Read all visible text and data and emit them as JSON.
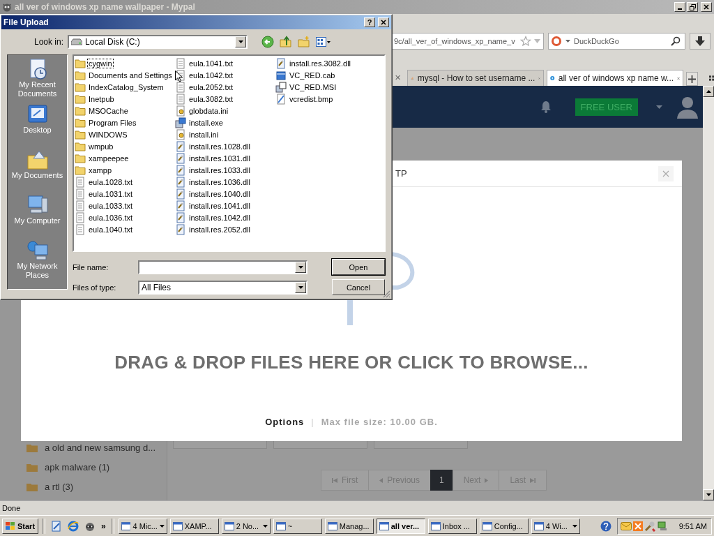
{
  "browser": {
    "title": "all ver of windows xp name wallpaper - Mypal",
    "address": {
      "value": "9c/all_ver_of_windows_xp_name_v"
    },
    "search": {
      "placeholder": "DuckDuckGo"
    },
    "tabs": [
      {
        "label": "mysql - How to set username ...",
        "selected": false
      },
      {
        "label": "all ver of windows xp name w...",
        "selected": true
      }
    ],
    "status": "Done"
  },
  "page": {
    "badge": "FREE USER",
    "folders": [
      "a old and new samsung d...",
      "apk malware (1)",
      "a rtl (3)"
    ],
    "pagination": [
      {
        "label": "First",
        "kind": "first",
        "selected": false
      },
      {
        "label": "Previous",
        "kind": "prev",
        "selected": false
      },
      {
        "label": "1",
        "kind": "page",
        "selected": true
      },
      {
        "label": "Next",
        "kind": "next",
        "selected": false
      },
      {
        "label": "Last",
        "kind": "last",
        "selected": false
      }
    ],
    "upload_modal": {
      "title": "TP",
      "prompt": "DRAG & DROP FILES HERE OR CLICK TO BROWSE...",
      "options": "Options",
      "separator": "|",
      "max_size": "Max file size: 10.00 GB."
    }
  },
  "dialog": {
    "title": "File Upload",
    "help_button": "?",
    "look_in_label": "Look in:",
    "look_in": "Local Disk (C:)",
    "places": [
      {
        "label": "My Recent Documents",
        "kind": "recent"
      },
      {
        "label": "Desktop",
        "kind": "desktop"
      },
      {
        "label": "My Documents",
        "kind": "documents"
      },
      {
        "label": "My Computer",
        "kind": "computer"
      },
      {
        "label": "My Network Places",
        "kind": "network"
      }
    ],
    "files": [
      {
        "name": "cygwin",
        "kind": "folder",
        "focused": true
      },
      {
        "name": "Documents and Settings",
        "kind": "folder",
        "focused": false
      },
      {
        "name": "IndexCatalog_System",
        "kind": "folder",
        "focused": false
      },
      {
        "name": "Inetpub",
        "kind": "folder",
        "focused": false
      },
      {
        "name": "MSOCache",
        "kind": "folder",
        "focused": false
      },
      {
        "name": "Program Files",
        "kind": "folder",
        "focused": false
      },
      {
        "name": "WINDOWS",
        "kind": "folder",
        "focused": false
      },
      {
        "name": "wmpub",
        "kind": "folder",
        "focused": false
      },
      {
        "name": "xampeepee",
        "kind": "folder",
        "focused": false
      },
      {
        "name": "xampp",
        "kind": "folder",
        "focused": false
      },
      {
        "name": "eula.1028.txt",
        "kind": "text",
        "focused": false
      },
      {
        "name": "eula.1031.txt",
        "kind": "text",
        "focused": false
      },
      {
        "name": "eula.1033.txt",
        "kind": "text",
        "focused": false
      },
      {
        "name": "eula.1036.txt",
        "kind": "text",
        "focused": false
      },
      {
        "name": "eula.1040.txt",
        "kind": "text",
        "focused": false
      },
      {
        "name": "eula.1041.txt",
        "kind": "text",
        "focused": false
      },
      {
        "name": "eula.1042.txt",
        "kind": "text",
        "focused": false
      },
      {
        "name": "eula.2052.txt",
        "kind": "text",
        "focused": false
      },
      {
        "name": "eula.3082.txt",
        "kind": "text",
        "focused": false
      },
      {
        "name": "globdata.ini",
        "kind": "ini",
        "focused": false
      },
      {
        "name": "install.exe",
        "kind": "exe",
        "focused": false
      },
      {
        "name": "install.ini",
        "kind": "ini",
        "focused": false
      },
      {
        "name": "install.res.1028.dll",
        "kind": "dll",
        "focused": false
      },
      {
        "name": "install.res.1031.dll",
        "kind": "dll",
        "focused": false
      },
      {
        "name": "install.res.1033.dll",
        "kind": "dll",
        "focused": false
      },
      {
        "name": "install.res.1036.dll",
        "kind": "dll",
        "focused": false
      },
      {
        "name": "install.res.1040.dll",
        "kind": "dll",
        "focused": false
      },
      {
        "name": "install.res.1041.dll",
        "kind": "dll",
        "focused": false
      },
      {
        "name": "install.res.1042.dll",
        "kind": "dll",
        "focused": false
      },
      {
        "name": "install.res.2052.dll",
        "kind": "dll",
        "focused": false
      },
      {
        "name": "install.res.3082.dll",
        "kind": "dll",
        "focused": false
      },
      {
        "name": "VC_RED.cab",
        "kind": "cab",
        "focused": false
      },
      {
        "name": "VC_RED.MSI",
        "kind": "msi",
        "focused": false
      },
      {
        "name": "vcredist.bmp",
        "kind": "bmp",
        "focused": false
      }
    ],
    "file_name_label": "File name:",
    "file_type_label": "Files of type:",
    "file_type": "All Files",
    "buttons": [
      {
        "label": "Open",
        "default": true
      },
      {
        "label": "Cancel",
        "default": false
      }
    ]
  },
  "taskbar": {
    "start": "Start",
    "more": "»",
    "tasks": [
      {
        "label": "4 Mic...",
        "grouped": true,
        "selected": false
      },
      {
        "label": "XAMP...",
        "grouped": false,
        "selected": false
      },
      {
        "label": "2 No...",
        "grouped": true,
        "selected": false
      },
      {
        "label": "~",
        "grouped": false,
        "selected": false
      },
      {
        "label": "Manag...",
        "grouped": false,
        "selected": false
      },
      {
        "label": "all ver...",
        "grouped": false,
        "selected": true
      },
      {
        "label": "Inbox ...",
        "grouped": false,
        "selected": false
      },
      {
        "label": "Config...",
        "grouped": false,
        "selected": false
      },
      {
        "label": "4 Wi...",
        "grouped": true,
        "selected": false
      }
    ],
    "clock": "9:51 AM"
  }
}
